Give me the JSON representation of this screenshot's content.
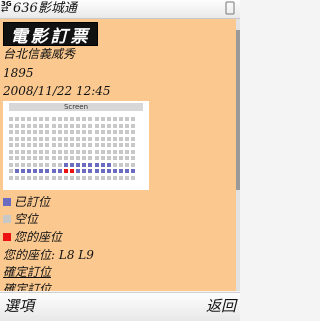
{
  "status_bar": {
    "network": "3G",
    "app_title": "636影城通"
  },
  "colors": {
    "panel_bg": "#fbc990",
    "booked": "#6b6bbf",
    "available": "#c8c8c8",
    "your_seat": "#ee1111"
  },
  "ticket": {
    "logo_text": "電影訂票",
    "cinema": "台北信義威秀",
    "movie": "1895",
    "datetime": "2008/11/22 12:45"
  },
  "seat_map": {
    "screen_label": "Screen",
    "rows": 10,
    "cols": 24,
    "booked_seats": [
      [
        7,
        10
      ],
      [
        7,
        11
      ],
      [
        7,
        12
      ],
      [
        7,
        13
      ],
      [
        7,
        14
      ],
      [
        7,
        15
      ],
      [
        7,
        16
      ],
      [
        7,
        17
      ],
      [
        7,
        18
      ],
      [
        8,
        1
      ],
      [
        8,
        2
      ],
      [
        8,
        3
      ],
      [
        8,
        4
      ],
      [
        8,
        5
      ],
      [
        8,
        6
      ],
      [
        8,
        7
      ],
      [
        8,
        8
      ],
      [
        8,
        9
      ],
      [
        8,
        12
      ],
      [
        8,
        13
      ],
      [
        8,
        14
      ],
      [
        8,
        15
      ],
      [
        8,
        16
      ],
      [
        8,
        17
      ],
      [
        8,
        18
      ],
      [
        8,
        19
      ],
      [
        8,
        20
      ],
      [
        8,
        21
      ],
      [
        8,
        22
      ],
      [
        8,
        23
      ]
    ],
    "your_seats": [
      [
        8,
        10
      ],
      [
        8,
        11
      ]
    ]
  },
  "legend": {
    "booked": "已訂位",
    "available": "空位",
    "yours": "您的座位"
  },
  "your_seats_line": "您的座位:  L8  L9",
  "confirm_label": "確定訂位",
  "confirm_label_partial": "確定訂位",
  "softkeys": {
    "left": "選項",
    "right": "返回"
  }
}
